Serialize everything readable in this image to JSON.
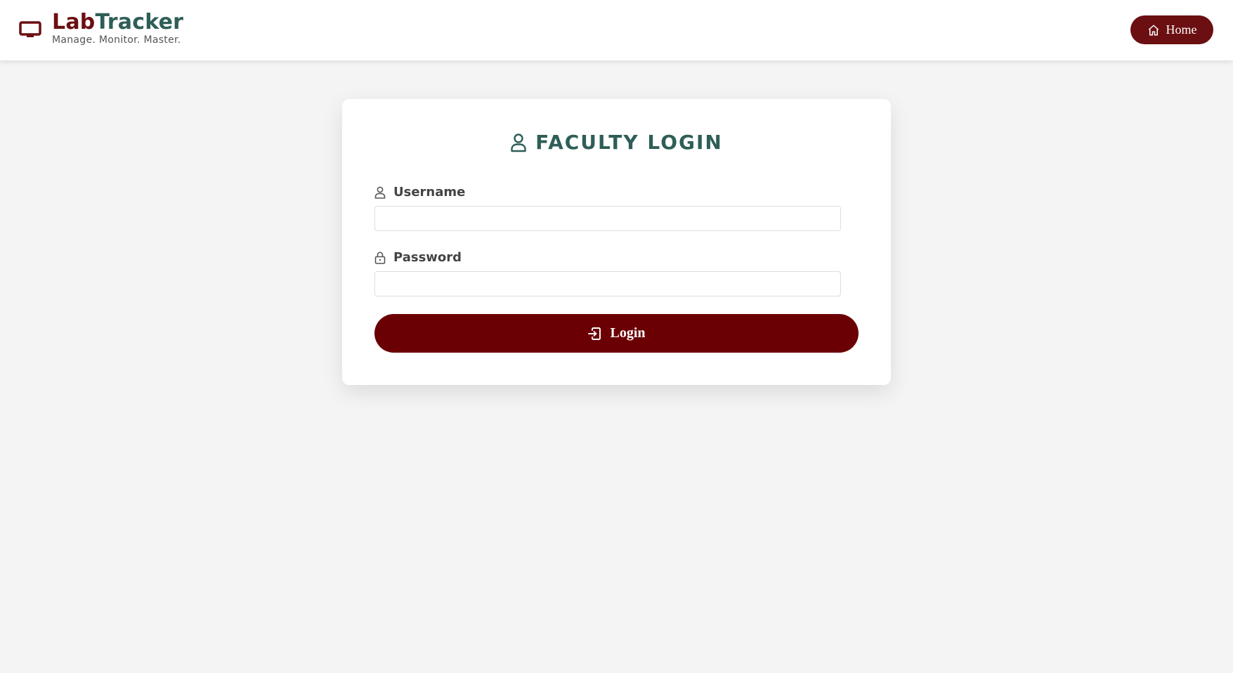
{
  "header": {
    "brand_part1": "Lab",
    "brand_part2": "Tracker",
    "tagline": "Manage. Monitor. Master.",
    "logo_icon": "monitor-icon",
    "home_icon": "home-icon",
    "home_label": "Home"
  },
  "login_form": {
    "title_icon": "user-icon",
    "title": "FACULTY LOGIN",
    "username": {
      "icon": "user-icon",
      "label": "Username",
      "value": "",
      "placeholder": ""
    },
    "password": {
      "icon": "lock-icon",
      "label": "Password",
      "value": "",
      "placeholder": ""
    },
    "submit_icon": "sign-in-icon",
    "submit_label": "Login"
  },
  "colors": {
    "brand_maroon": "#6b0f12",
    "brand_teal": "#2e5e57",
    "button_maroon": "#6b0004",
    "page_background": "#f4f4f4",
    "card_background": "#ffffff"
  }
}
